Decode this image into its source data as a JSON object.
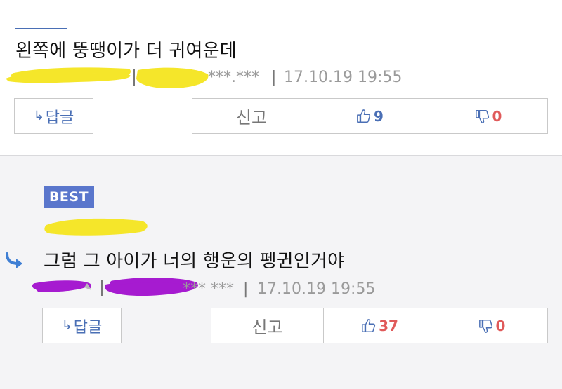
{
  "comments": [
    {
      "text": "왼쪽에 뚱땡이가 더 귀여운데",
      "ip_masked": "***.***",
      "datetime": "17.10.19 19:55",
      "buttons": {
        "reply": "답글",
        "report": "신고",
        "like_count": "9",
        "dislike_count": "0"
      }
    },
    {
      "badge": "BEST",
      "text": "그럼 그 아이가 너의 행운의 펭귄인거야",
      "ip_masked": "*** ***",
      "datetime": "17.10.19 19:55",
      "buttons": {
        "reply": "답글",
        "report": "신고",
        "like_count": "37",
        "dislike_count": "0"
      }
    }
  ],
  "colors": {
    "accent": "#4a6fb5",
    "badge": "#5a76cc",
    "dislike": "#e05a5a",
    "redaction_yellow": "#f5e62a",
    "redaction_purple": "#a61bd0"
  },
  "icons": [
    "reply-arrow-icon",
    "thumbs-up-icon",
    "thumbs-down-icon"
  ]
}
